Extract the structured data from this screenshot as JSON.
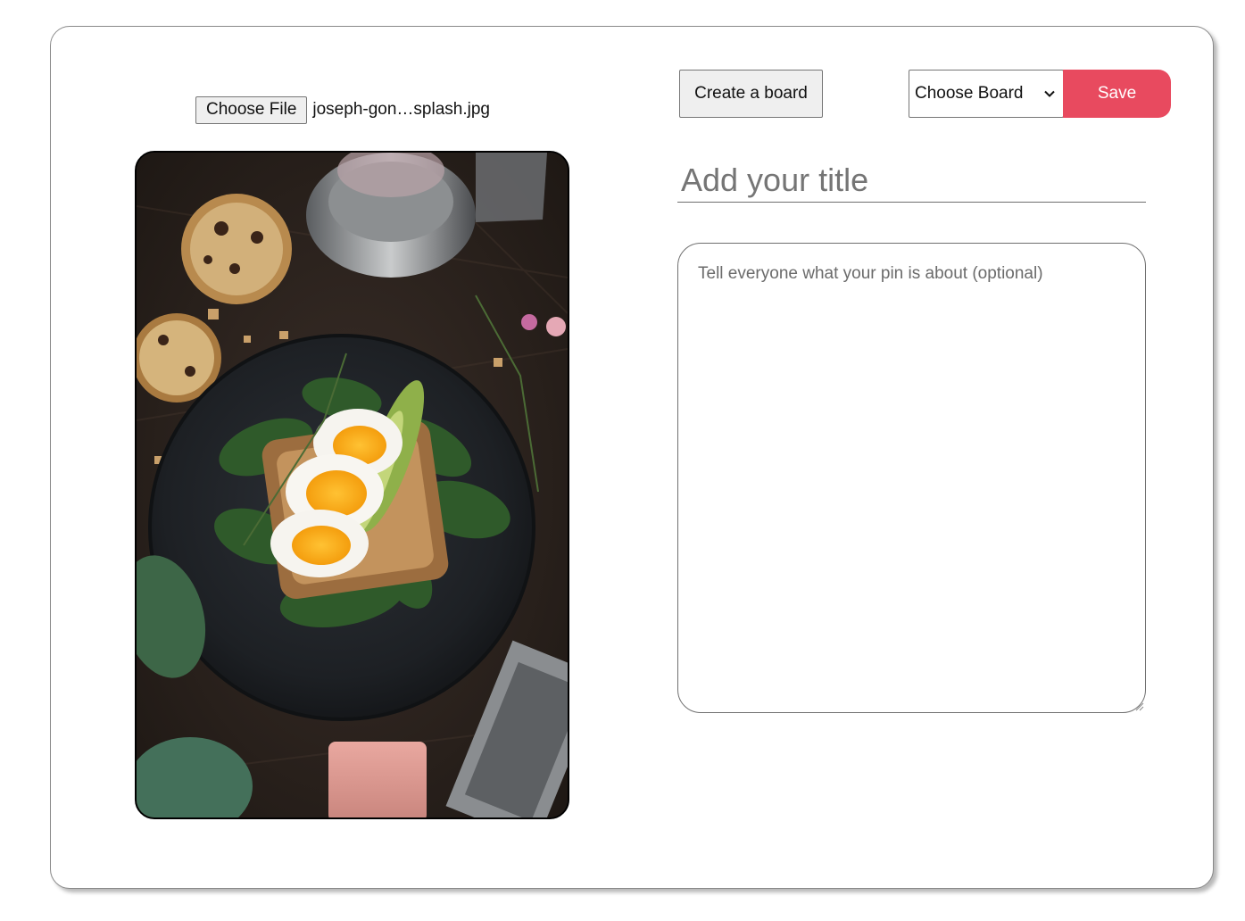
{
  "file_picker": {
    "button_label": "Choose File",
    "file_name": "joseph-gon…splash.jpg"
  },
  "photo": {
    "description_icon": "food-photo"
  },
  "toolbar": {
    "create_board_label": "Create a board",
    "board_select_value": "Choose Board",
    "save_label": "Save"
  },
  "form": {
    "title_placeholder": "Add your title",
    "description_placeholder": "Tell everyone what your pin is about (optional)"
  },
  "colors": {
    "save_button": "#e84a5f",
    "button_gray": "#efefef"
  }
}
